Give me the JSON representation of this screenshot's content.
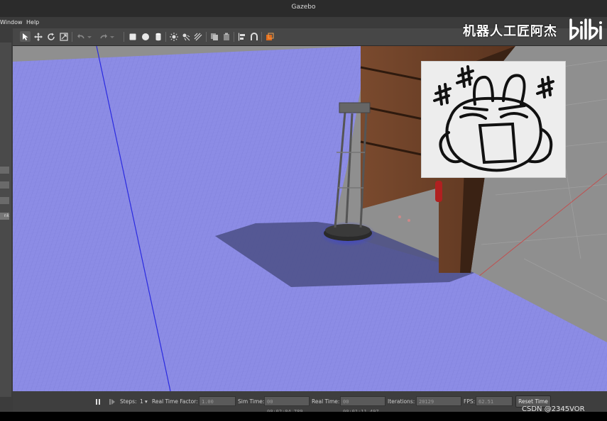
{
  "window": {
    "title": "Gazebo"
  },
  "menu": {
    "window_label": "Window",
    "help_label": "Help"
  },
  "left_panel": {
    "partial_label": "nk"
  },
  "toolbar": {
    "tools": [
      "select-mode",
      "translate-mode",
      "rotate-mode",
      "scale-mode",
      "undo",
      "redo",
      "box-shape",
      "sphere-shape",
      "cylinder-shape",
      "point-light",
      "spot-light",
      "directional-light",
      "copy",
      "paste",
      "align",
      "snap",
      "change-view"
    ]
  },
  "overlay": {
    "watermark": "机器人工匠阿杰",
    "bili_logo": "bilibili",
    "credit": "CSDN @2345VOR"
  },
  "status": {
    "steps_label": "Steps:",
    "steps_value": "1",
    "rtf_label": "Real Time Factor:",
    "rtf_value": "1.00",
    "sim_time_label": "Sim Time:",
    "sim_time_value": "00 00:02:04.789",
    "real_time_label": "Real Time:",
    "real_time_value": "00 00:01:11.497",
    "iterations_label": "Iterations:",
    "iterations_value": "20129",
    "fps_label": "FPS:",
    "fps_value": "62.51",
    "reset_label": "Reset Time"
  },
  "colors": {
    "ground": "#8c8ce6",
    "laser": "#2030ff",
    "wall": "#6b4028"
  }
}
